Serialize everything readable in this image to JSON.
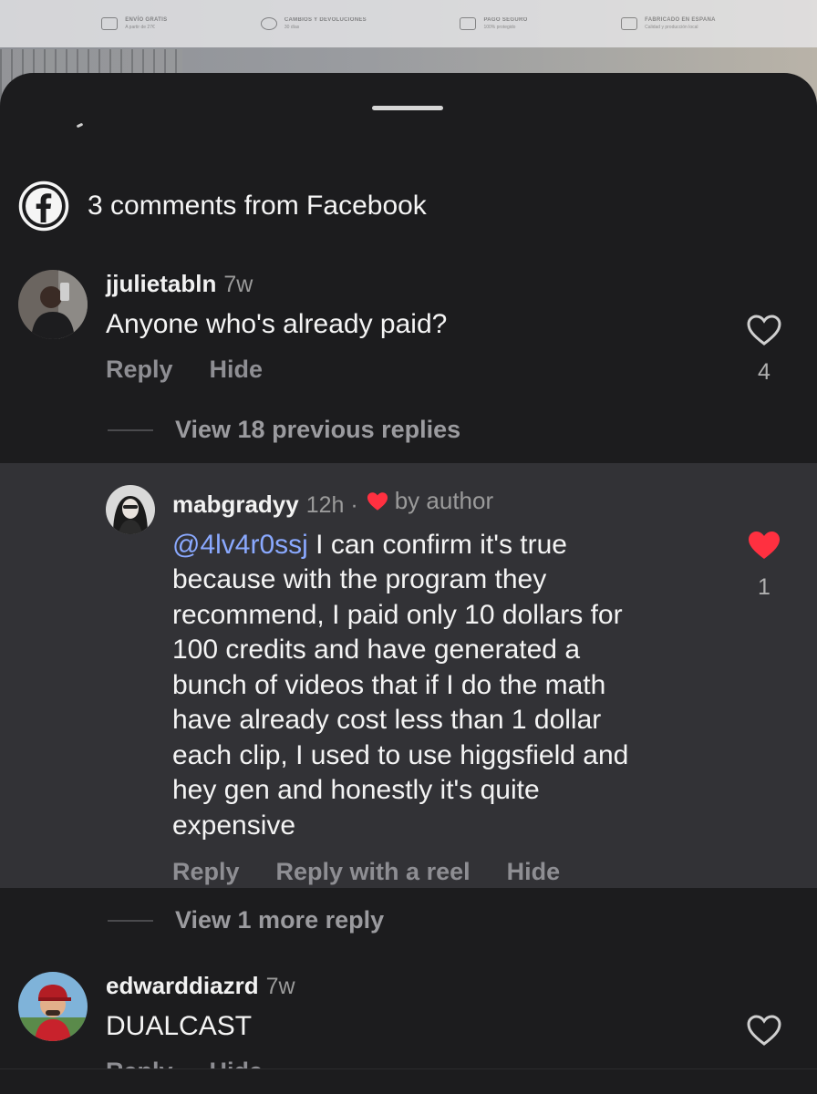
{
  "background": {
    "features": [
      {
        "title": "ENVÍO GRATIS",
        "sub": "A partir de 27€",
        "icon": "truck-icon"
      },
      {
        "title": "CAMBIOS Y DEVOLUCIONES",
        "sub": "30 días",
        "icon": "refresh-icon"
      },
      {
        "title": "PAGO SEGURO",
        "sub": "100% protegido",
        "icon": "lock-icon"
      },
      {
        "title": "FABRICADO EN ESPAÑA",
        "sub": "Calidad y producción local",
        "icon": "map-icon"
      }
    ]
  },
  "header": {
    "title": "3 comments from Facebook",
    "icon": "facebook-icon"
  },
  "comments": [
    {
      "username": "jjulietabln",
      "time": "7w",
      "text": "Anyone who's already paid?",
      "reply_label": "Reply",
      "hide_label": "Hide",
      "likes": "4",
      "liked": false,
      "view_replies": "View 18 previous replies"
    },
    {
      "username": "mabgradyy",
      "time": "12h ·",
      "by_author": "by author",
      "mention": "@4lv4r0ssj",
      "text_lines": [
        " I can confirm it's true",
        "because with the program they",
        "recommend, I paid only 10 dollars for",
        "100 credits and have generated a",
        "bunch of videos that if I do the math",
        "have already cost less than 1 dollar",
        "each clip, I used to use higgsfield and",
        "hey gen and honestly it's quite",
        "expensive"
      ],
      "reply_label": "Reply",
      "reply_reel_label": "Reply with a reel",
      "hide_label": "Hide",
      "likes": "1",
      "liked": true,
      "view_replies": "View 1 more reply"
    },
    {
      "username": "edwarddiazrd",
      "time": "7w",
      "text": "DUALCAST",
      "reply_label": "Reply",
      "hide_label": "Hide",
      "liked": false
    }
  ],
  "colors": {
    "sheet_bg": "#1c1c1e",
    "highlight_bg": "#323236",
    "mention": "#8aa9ff",
    "heart_red": "#ff3040",
    "muted": "#8e8e93"
  }
}
